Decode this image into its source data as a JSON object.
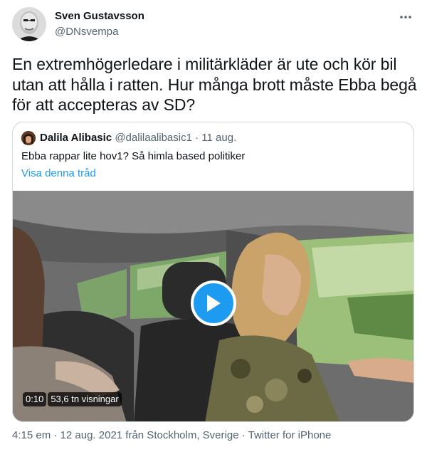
{
  "author": {
    "name": "Sven Gustavsson",
    "handle": "@DNsvempa",
    "avatar_icon": "profile-photo"
  },
  "tweet": {
    "text": "En extremhögerledare i militärkläder är ute och kör bil utan att hålla i ratten. Hur många brott måste Ebba begå för att accepteras av SD?"
  },
  "quoted_tweet": {
    "name": "Dalila Alibasic",
    "handle": "@dalilaalibasic1",
    "separator": "·",
    "date": "11 aug.",
    "text": "Ebba rappar lite hov1? Så himla based politiker",
    "thread_link": "Visa denna tråd",
    "video": {
      "duration": "0:10",
      "views": "53,6 tn visningar",
      "play_icon": "play-icon"
    }
  },
  "footer": {
    "time": "4:15 em",
    "date": "12 aug. 2021 från Stockholm, Sverige",
    "source": "Twitter for iPhone",
    "separator": "·"
  },
  "colors": {
    "accent": "#1d9bf0",
    "text": "#0f1419",
    "secondary": "#536471",
    "border": "#cfd9de"
  }
}
